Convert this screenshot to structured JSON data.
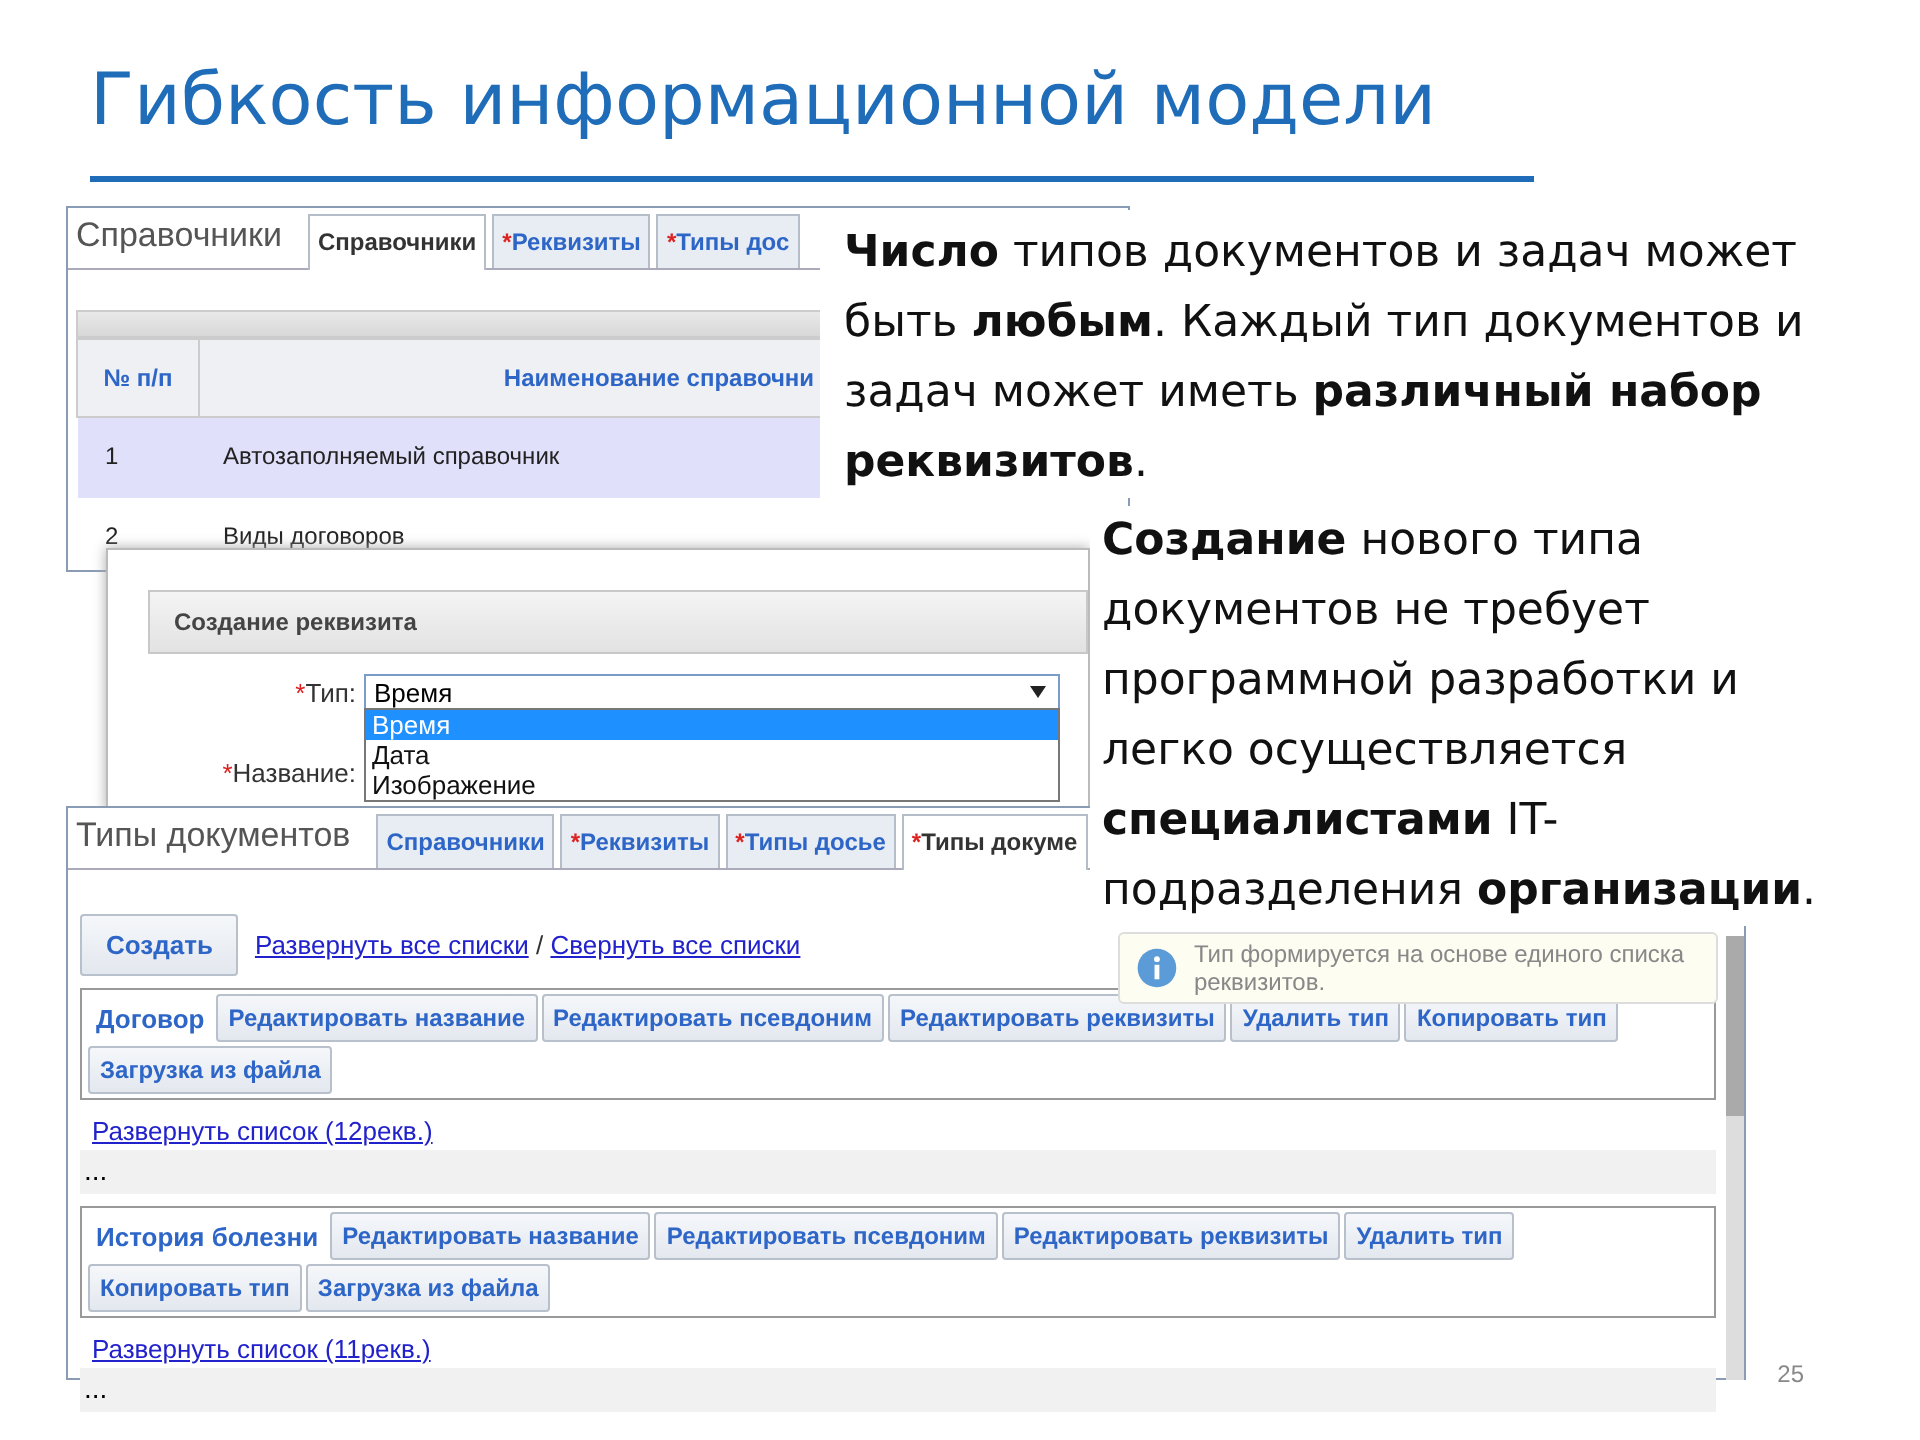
{
  "slide": {
    "title": "Гибкость информационной модели",
    "page_number": "25"
  },
  "directory_window": {
    "title": "Справочники",
    "tabs": [
      {
        "label": "Справочники",
        "selected": true
      },
      {
        "mark": "*",
        "label": "Реквизиты",
        "selected": false
      },
      {
        "mark": "*",
        "label": "Типы дос",
        "selected": false
      }
    ],
    "table": {
      "columns": [
        "№ п/п",
        "Наименование справочни"
      ],
      "rows": [
        {
          "cells": [
            "1",
            "Автозаполняемый справочник"
          ],
          "selected": true
        },
        {
          "cells": [
            "2",
            "Виды договоров"
          ],
          "selected": false
        }
      ]
    }
  },
  "text_blocks": [
    {
      "text": "**Число** типов документов и задач может быть **любым**. Каждый тип документов и задач может иметь **различный набор реквизитов**."
    },
    {
      "text": "**Создание** нового типа документов не требует программной разработки и легко осуществляется **специалистами** IT-подразделения **организации**."
    }
  ],
  "dialog": {
    "title": "Создание реквизита",
    "fields": [
      {
        "kind": "select",
        "mark": "*",
        "label": "Тип:",
        "value": "Время",
        "expanded": true,
        "options": [
          {
            "label": "Время",
            "selected": true
          },
          {
            "label": "Дата",
            "selected": false
          },
          {
            "label": "Изображение",
            "selected": false
          }
        ]
      },
      {
        "kind": "text",
        "mark": "*",
        "label": "Название:"
      }
    ]
  },
  "documents_window": {
    "title": "Типы документов",
    "tabs": [
      {
        "label": "Справочники",
        "selected": false
      },
      {
        "mark": "*",
        "label": "Реквизиты",
        "selected": false
      },
      {
        "mark": "*",
        "label": "Типы досье",
        "selected": false
      },
      {
        "mark": "*",
        "label": "Типы докуме",
        "selected": true
      }
    ],
    "toolbar": {
      "create_button": "Создать",
      "links": [
        "Развернуть все списки",
        "Свернуть все списки"
      ],
      "separator": "/"
    },
    "tooltip": "Тип формируется на основе единого списка реквизитов.",
    "groups": [
      {
        "name": "Договор",
        "actions": [
          "Редактировать название",
          "Редактировать псевдоним",
          "Редактировать реквизиты",
          "Удалить тип",
          "Копировать тип",
          "Загрузка из файла"
        ],
        "expand_link": "Развернуть список (12рекв.)",
        "more": "..."
      },
      {
        "name": "История болезни",
        "actions": [
          "Редактировать название",
          "Редактировать псевдоним",
          "Редактировать реквизиты",
          "Удалить тип",
          "Копировать тип",
          "Загрузка из файла"
        ],
        "expand_link": "Развернуть список (11рекв.)",
        "more": "..."
      }
    ]
  }
}
